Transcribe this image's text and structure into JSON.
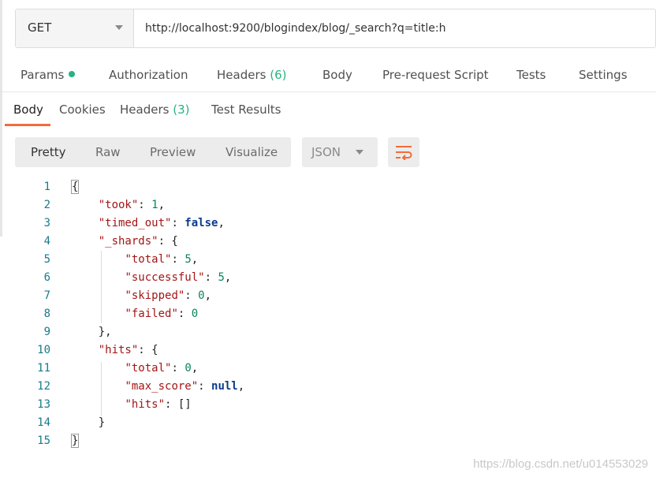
{
  "request": {
    "method": "GET",
    "url": "http://localhost:9200/blogindex/blog/_search?q=title:h"
  },
  "request_tabs": {
    "params": "Params",
    "authorization": "Authorization",
    "headers": "Headers",
    "headers_count": "(6)",
    "body": "Body",
    "prerequest": "Pre-request Script",
    "tests": "Tests",
    "settings": "Settings"
  },
  "response_tabs": {
    "body": "Body",
    "cookies": "Cookies",
    "headers": "Headers",
    "headers_count": "(3)",
    "test_results": "Test Results"
  },
  "view_options": {
    "pretty": "Pretty",
    "raw": "Raw",
    "preview": "Preview",
    "visualize": "Visualize",
    "format": "JSON"
  },
  "code": {
    "line_numbers": [
      "1",
      "2",
      "3",
      "4",
      "5",
      "6",
      "7",
      "8",
      "9",
      "10",
      "11",
      "12",
      "13",
      "14",
      "15"
    ],
    "l1_open": "{",
    "l2_key": "\"took\"",
    "l2_val": "1",
    "l3_key": "\"timed_out\"",
    "l3_val": "false",
    "l4_key": "\"_shards\"",
    "l5_key": "\"total\"",
    "l5_val": "5",
    "l6_key": "\"successful\"",
    "l6_val": "5",
    "l7_key": "\"skipped\"",
    "l7_val": "0",
    "l8_key": "\"failed\"",
    "l8_val": "0",
    "l10_key": "\"hits\"",
    "l11_key": "\"total\"",
    "l11_val": "0",
    "l12_key": "\"max_score\"",
    "l12_val": "null",
    "l13_key": "\"hits\"",
    "l13_val": "[]",
    "l15_close": "}"
  },
  "watermark": "https://blog.csdn.net/u014553029",
  "colors": {
    "accent": "#f26b3a",
    "count_green": "#26b47f",
    "json_key": "#a31515",
    "json_number": "#098658",
    "json_keyword": "#0b3b8c",
    "line_number": "#1a7a8c"
  }
}
